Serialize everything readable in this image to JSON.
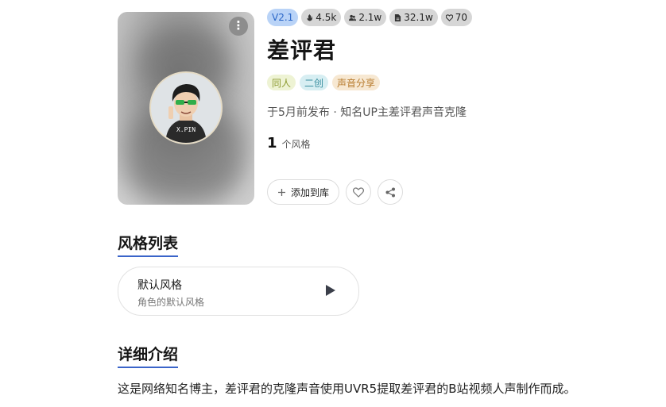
{
  "header": {
    "badges": [
      {
        "label": "V2.1",
        "icon": "version-icon"
      },
      {
        "label": "4.5k",
        "icon": "fire-icon"
      },
      {
        "label": "2.1w",
        "icon": "users-icon"
      },
      {
        "label": "32.1w",
        "icon": "document-icon"
      },
      {
        "label": "70",
        "icon": "heart-icon"
      }
    ],
    "title": "差评君",
    "tags": [
      "同人",
      "二创",
      "声音分享"
    ],
    "meta": "于5月前发布 · 知名UP主差评君声音克隆",
    "style_count": "1",
    "style_count_unit": "个风格",
    "add_button_label": "添加到库"
  },
  "styles_section": {
    "title": "风格列表",
    "items": [
      {
        "name": "默认风格",
        "desc": "角色的默认风格"
      }
    ]
  },
  "intro_section": {
    "title": "详细介绍",
    "text": "这是网络知名博主，差评君的克隆声音使用UVR5提取差评君的B站视频人声制作而成。"
  },
  "avatar_text": "X.PIN",
  "colors": {
    "accent": "#3a64c9",
    "version_badge_bg": "#b9d3f7",
    "stat_badge_bg": "#d6d6d6"
  }
}
